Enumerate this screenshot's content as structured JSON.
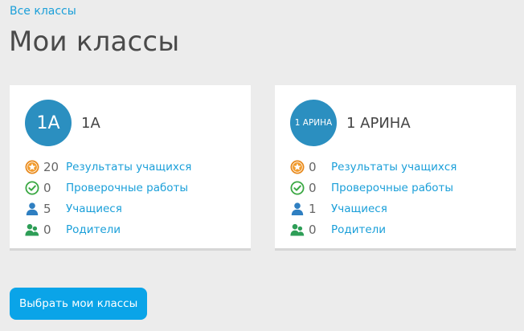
{
  "breadcrumb": {
    "label": "Все классы"
  },
  "page_title": "Мои классы",
  "classes": [
    {
      "avatar_label": "1А",
      "name": "1А",
      "stats": {
        "results": {
          "count": "20",
          "label": "Результаты учащихся"
        },
        "tests": {
          "count": "0",
          "label": "Проверочные работы"
        },
        "students": {
          "count": "5",
          "label": "Учащиеся"
        },
        "parents": {
          "count": "0",
          "label": "Родители"
        }
      }
    },
    {
      "avatar_label": "1 АРИНА",
      "name": "1 АРИНА",
      "stats": {
        "results": {
          "count": "0",
          "label": "Результаты учащихся"
        },
        "tests": {
          "count": "0",
          "label": "Проверочные работы"
        },
        "students": {
          "count": "1",
          "label": "Учащиеся"
        },
        "parents": {
          "count": "0",
          "label": "Родители"
        }
      }
    }
  ],
  "select_button": {
    "label": "Выбрать мои классы"
  },
  "icons": {
    "results": "star-badge-icon",
    "tests": "check-circle-icon",
    "students": "user-icon",
    "parents": "users-icon"
  },
  "colors": {
    "link": "#1a9fd9",
    "avatar": "#2b8fc0",
    "button": "#0aa4e8",
    "star_badge": "#e8891c",
    "check": "#3aa843",
    "user": "#2f7fc1",
    "parents": "#2e9e57"
  }
}
